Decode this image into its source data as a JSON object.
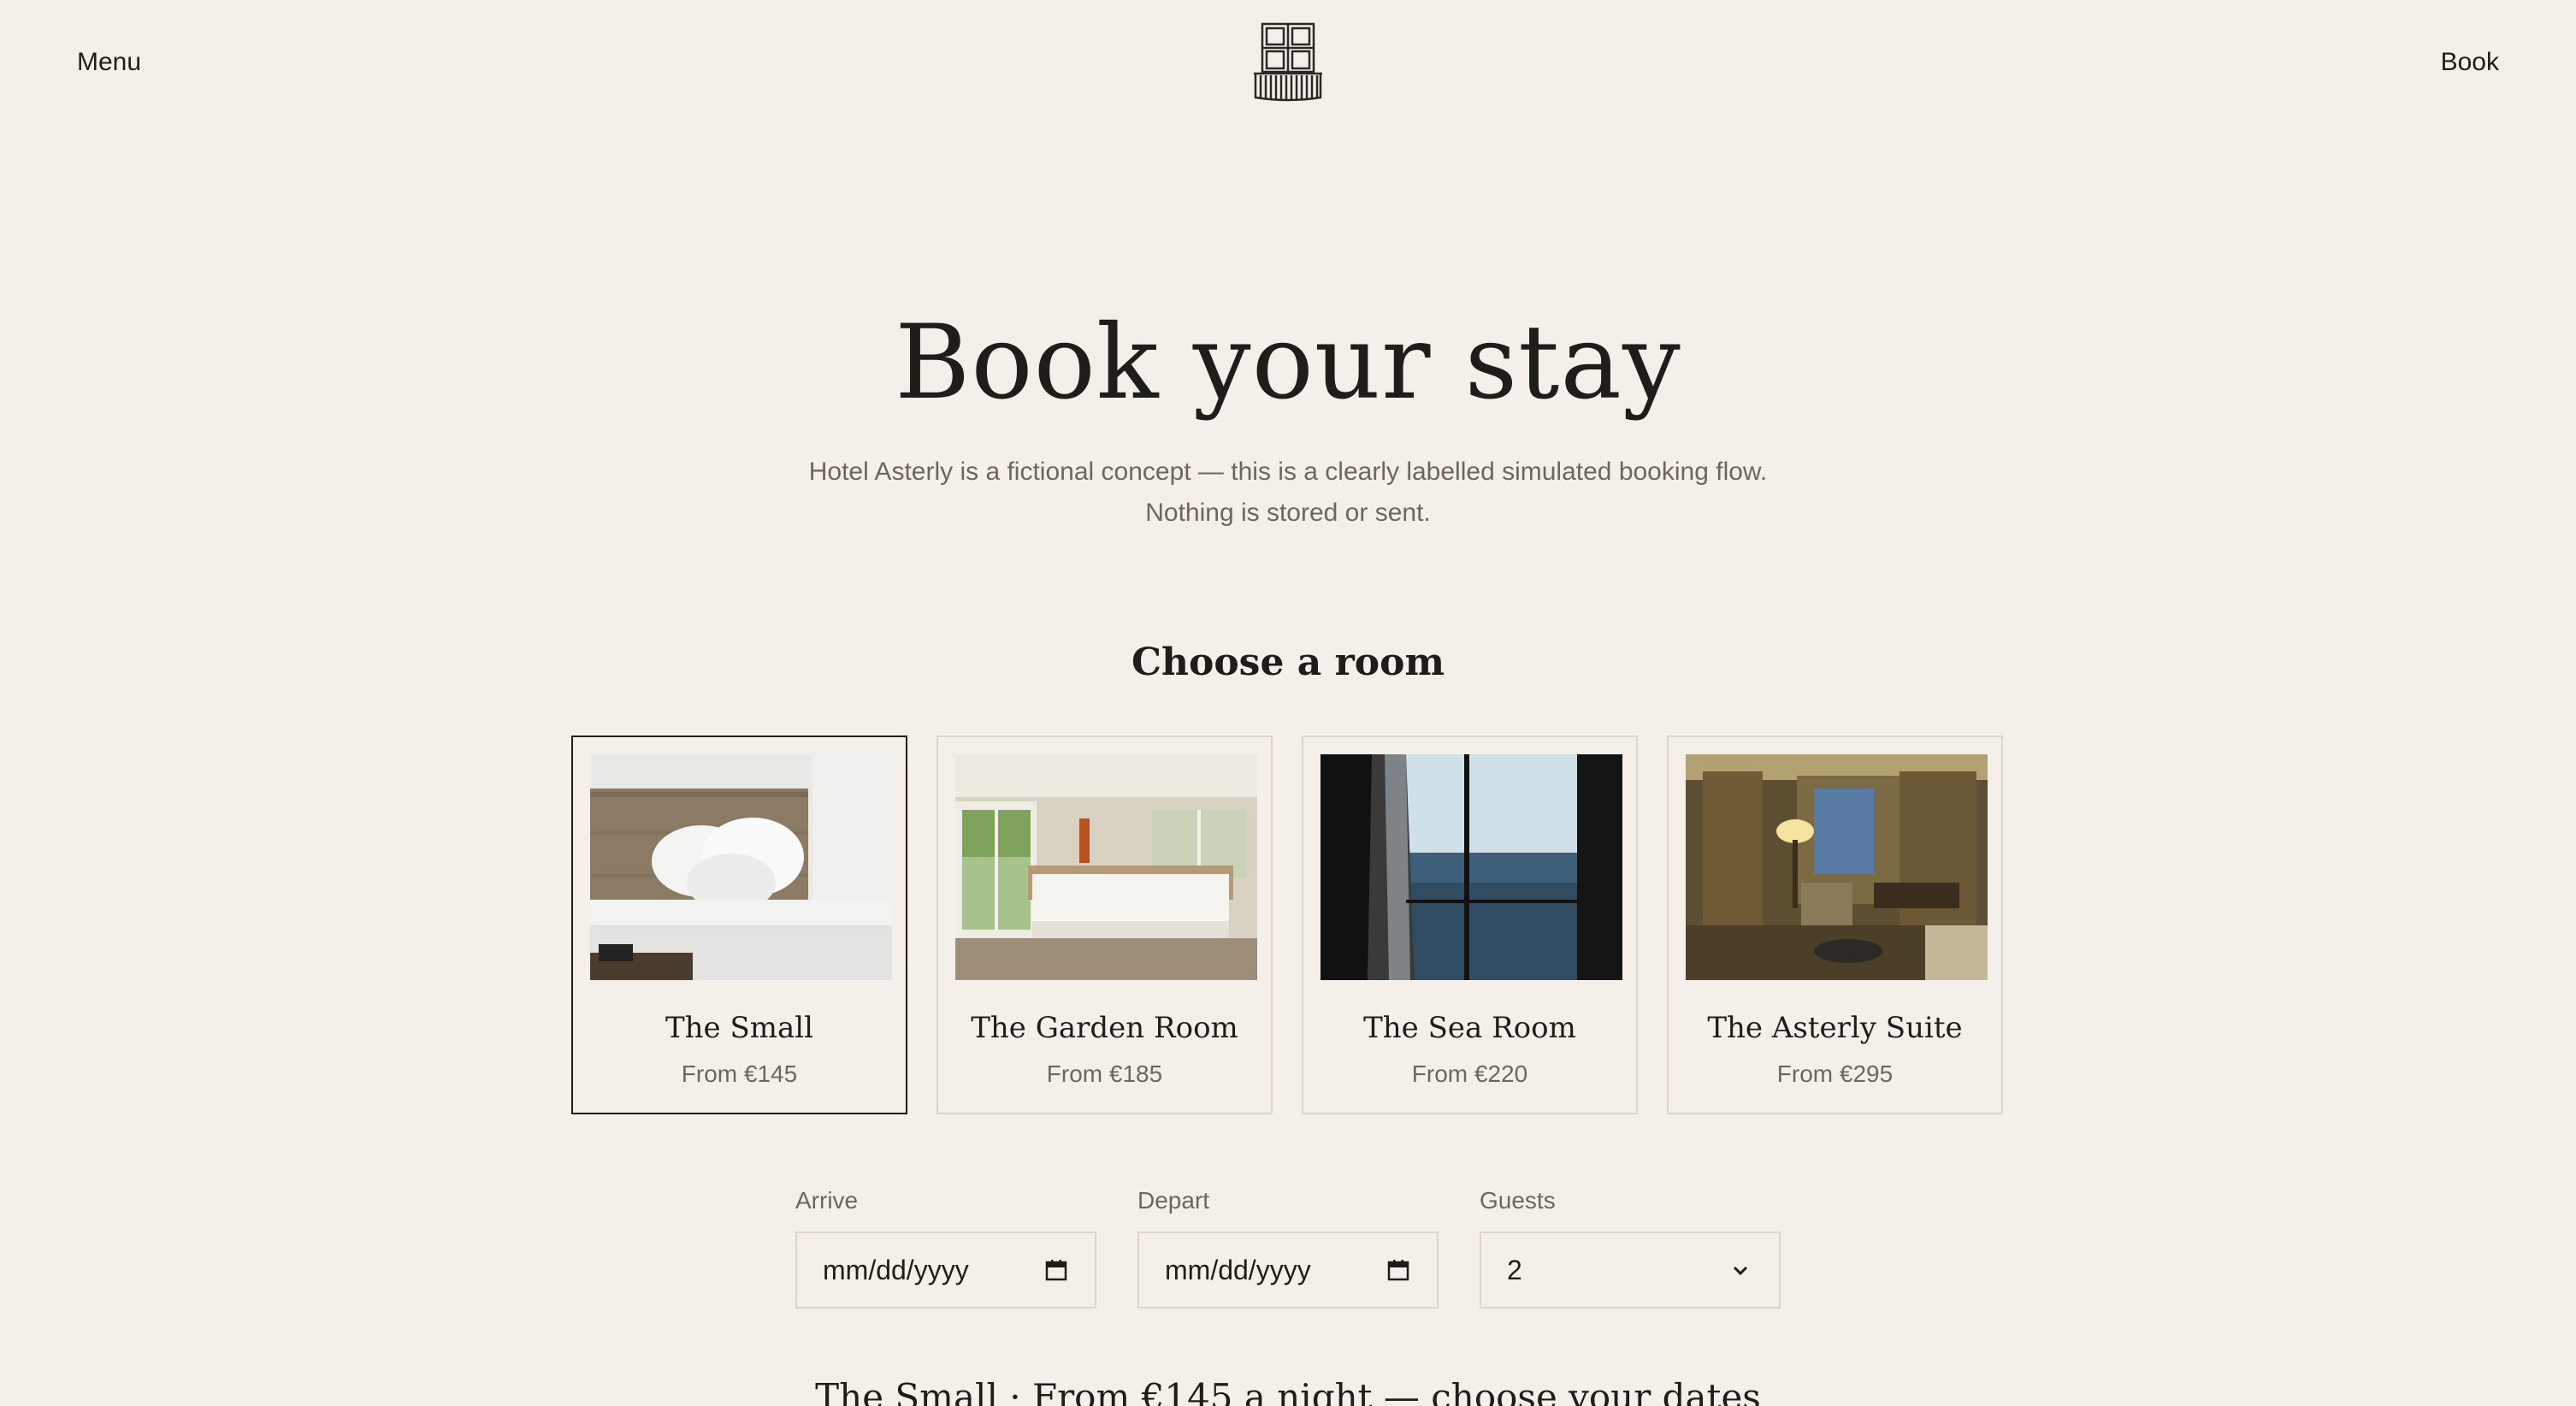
{
  "header": {
    "menu_label": "Menu",
    "book_label": "Book",
    "logo_icon": "hotel-window-balcony-icon"
  },
  "hero": {
    "title": "Book your stay",
    "subtitle": "Hotel Asterly is a fictional concept — this is a clearly labelled simulated booking flow. Nothing is stored or sent."
  },
  "rooms_section": {
    "title": "Choose a room",
    "rooms": [
      {
        "name": "The Small",
        "price": "From €145",
        "selected": true
      },
      {
        "name": "The Garden Room",
        "price": "From €185",
        "selected": false
      },
      {
        "name": "The Sea Room",
        "price": "From €220",
        "selected": false
      },
      {
        "name": "The Asterly Suite",
        "price": "From €295",
        "selected": false
      }
    ]
  },
  "form": {
    "arrive": {
      "label": "Arrive",
      "value": "mm/dd/yyyy"
    },
    "depart": {
      "label": "Depart",
      "value": "mm/dd/yyyy"
    },
    "guests": {
      "label": "Guests",
      "value": "2"
    }
  },
  "summary": "The Small · From €145 a night — choose your dates",
  "colors": {
    "background": "#f4f0e9",
    "text": "#1f1d1a",
    "muted": "#6d665d",
    "border": "#ddd5c9"
  }
}
